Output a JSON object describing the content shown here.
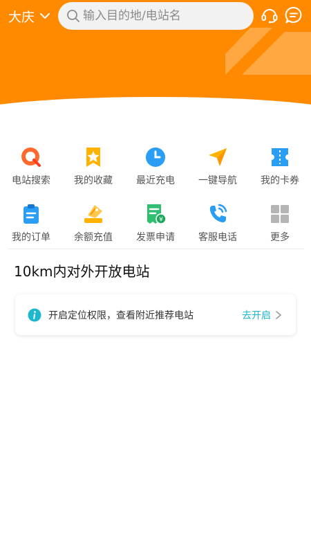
{
  "header": {
    "city": "大庆",
    "search_placeholder": "输入目的地/电站名",
    "brand_color": "#ff8a00",
    "icons": [
      "chevron-down-icon",
      "search-icon",
      "headset-icon",
      "message-icon"
    ]
  },
  "quick_menu": {
    "row1": [
      {
        "label": "电站搜索",
        "icon": "station-search-icon",
        "color": "#ff6a2c"
      },
      {
        "label": "我的收藏",
        "icon": "favorite-star-icon",
        "color": "#ffb300"
      },
      {
        "label": "最近充电",
        "icon": "clock-icon",
        "color": "#2a9df4"
      },
      {
        "label": "一键导航",
        "icon": "navigation-icon",
        "color": "#ffb300"
      },
      {
        "label": "我的卡券",
        "icon": "coupon-icon",
        "color": "#2a9df4"
      }
    ],
    "row2": [
      {
        "label": "我的订单",
        "icon": "order-clipboard-icon",
        "color": "#2a9df4"
      },
      {
        "label": "余额充值",
        "icon": "recharge-tag-icon",
        "color": "#ffb300"
      },
      {
        "label": "发票申请",
        "icon": "invoice-icon",
        "color": "#2fbf71"
      },
      {
        "label": "客服电话",
        "icon": "phone-icon",
        "color": "#2a9df4"
      },
      {
        "label": "更多",
        "icon": "grid-more-icon",
        "color": "#b5b5b5"
      }
    ]
  },
  "nearby": {
    "title": "10km内对外开放电站"
  },
  "notice": {
    "text": "开启定位权限，查看附近推荐电站",
    "action": "去开启",
    "accent": "#1bb8cf"
  }
}
